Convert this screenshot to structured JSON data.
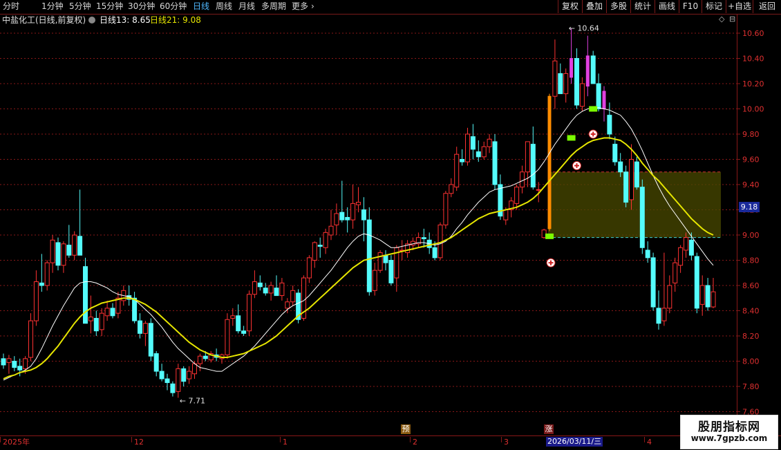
{
  "toolbar": {
    "periods": [
      "分时",
      "1分钟",
      "5分钟",
      "15分钟",
      "30分钟",
      "60分钟",
      "日线",
      "周线",
      "月线",
      "多周期",
      "更多"
    ],
    "active": "日线",
    "buttons": [
      "复权",
      "叠加",
      "多股",
      "统计",
      "画线",
      "F10",
      "标记",
      "+自选",
      "返回"
    ]
  },
  "info": {
    "stock": "中盐化工(日线,前复权)",
    "ma13_label": "日线13: 8.65",
    "ma21_label": "日线21: 9.08"
  },
  "price_axis": {
    "ticks": [
      "10.60",
      "10.40",
      "10.20",
      "10.00",
      "9.80",
      "9.60",
      "9.40",
      "9.20",
      "9.00",
      "8.80",
      "8.60",
      "8.40",
      "8.20",
      "8.00",
      "7.80",
      "7.60"
    ],
    "last_price": "9.18"
  },
  "annotations": {
    "high": "10.64",
    "low": "7.71",
    "tag_yu": "预",
    "tag_zhang": "涨"
  },
  "date_axis": {
    "labels": [
      "2025年",
      "12",
      "1",
      "2",
      "3",
      "4"
    ],
    "selected_date": "2026/03/11/三"
  },
  "colors": {
    "up": "#ff3232",
    "down": "#54fcfc",
    "ma13": "#ffffff",
    "ma21": "#e6e600",
    "grid": "#8a1818",
    "purple": "#e040e0",
    "green": "#7cfc00",
    "orange": "#ff8c00"
  },
  "chart_data": {
    "type": "candlestick",
    "ylim": [
      7.6,
      10.7
    ],
    "ohlc": [
      [
        8.02,
        8.06,
        7.94,
        7.97
      ],
      [
        7.99,
        8.05,
        7.9,
        8.02
      ],
      [
        8.0,
        8.04,
        7.92,
        7.95
      ],
      [
        7.96,
        8.02,
        7.88,
        7.93
      ],
      [
        7.94,
        8.04,
        7.9,
        8.02
      ],
      [
        8.03,
        8.38,
        8.0,
        8.32
      ],
      [
        8.32,
        8.72,
        8.28,
        8.63
      ],
      [
        8.62,
        8.85,
        8.55,
        8.6
      ],
      [
        8.6,
        8.8,
        8.56,
        8.78
      ],
      [
        8.78,
        9.0,
        8.7,
        8.96
      ],
      [
        8.94,
        8.98,
        8.72,
        8.76
      ],
      [
        8.76,
        8.95,
        8.7,
        8.93
      ],
      [
        8.92,
        9.08,
        8.82,
        8.84
      ],
      [
        8.84,
        9.03,
        8.8,
        9.0
      ],
      [
        8.99,
        9.36,
        8.86,
        8.84
      ],
      [
        8.75,
        8.82,
        8.3,
        8.3
      ],
      [
        8.32,
        8.52,
        8.22,
        8.35
      ],
      [
        8.34,
        8.4,
        8.2,
        8.24
      ],
      [
        8.25,
        8.42,
        8.2,
        8.38
      ],
      [
        8.36,
        8.48,
        8.32,
        8.42
      ],
      [
        8.42,
        8.46,
        8.34,
        8.36
      ],
      [
        8.38,
        8.55,
        8.34,
        8.5
      ],
      [
        8.48,
        8.6,
        8.44,
        8.56
      ],
      [
        8.52,
        8.6,
        8.44,
        8.49
      ],
      [
        8.5,
        8.55,
        8.3,
        8.32
      ],
      [
        8.32,
        8.38,
        8.18,
        8.22
      ],
      [
        8.22,
        8.32,
        8.12,
        8.3
      ],
      [
        8.3,
        8.34,
        8.0,
        8.04
      ],
      [
        8.06,
        8.08,
        7.88,
        7.92
      ],
      [
        7.92,
        7.98,
        7.84,
        7.86
      ],
      [
        7.86,
        7.9,
        7.77,
        7.83
      ],
      [
        7.82,
        7.84,
        7.72,
        7.75
      ],
      [
        7.76,
        7.98,
        7.71,
        7.94
      ],
      [
        7.94,
        7.96,
        7.8,
        7.84
      ],
      [
        7.86,
        7.96,
        7.82,
        7.92
      ],
      [
        7.9,
        8.0,
        7.86,
        7.98
      ],
      [
        7.98,
        8.06,
        7.92,
        8.04
      ],
      [
        8.04,
        8.08,
        8.0,
        8.02
      ],
      [
        8.01,
        8.08,
        7.99,
        8.06
      ],
      [
        8.05,
        8.1,
        8.0,
        8.03
      ],
      [
        8.02,
        8.06,
        7.98,
        8.05
      ],
      [
        8.05,
        8.38,
        8.02,
        8.33
      ],
      [
        8.34,
        8.42,
        8.28,
        8.36
      ],
      [
        8.36,
        8.45,
        8.22,
        8.24
      ],
      [
        8.24,
        8.28,
        8.2,
        8.22
      ],
      [
        8.24,
        8.56,
        8.2,
        8.53
      ],
      [
        8.53,
        8.72,
        8.5,
        8.63
      ],
      [
        8.62,
        8.68,
        8.56,
        8.59
      ],
      [
        8.58,
        8.62,
        8.52,
        8.54
      ],
      [
        8.54,
        8.63,
        8.48,
        8.6
      ],
      [
        8.58,
        8.68,
        8.52,
        8.52
      ],
      [
        8.52,
        8.66,
        8.48,
        8.62
      ],
      [
        8.42,
        8.5,
        8.38,
        8.47
      ],
      [
        8.47,
        8.6,
        8.44,
        8.56
      ],
      [
        8.54,
        8.57,
        8.3,
        8.33
      ],
      [
        8.34,
        8.68,
        8.32,
        8.66
      ],
      [
        8.66,
        8.84,
        8.62,
        8.82
      ],
      [
        8.8,
        8.95,
        8.74,
        8.94
      ],
      [
        8.92,
        8.98,
        8.82,
        8.91
      ],
      [
        8.9,
        9.05,
        8.85,
        9.02
      ],
      [
        9.0,
        9.2,
        8.96,
        9.07
      ],
      [
        9.08,
        9.25,
        9.0,
        9.17
      ],
      [
        9.18,
        9.43,
        9.1,
        9.12
      ],
      [
        9.14,
        9.22,
        9.02,
        9.12
      ],
      [
        9.12,
        9.4,
        9.05,
        9.25
      ],
      [
        9.24,
        9.38,
        9.18,
        9.26
      ],
      [
        9.2,
        9.3,
        8.95,
        9.12
      ],
      [
        9.12,
        9.22,
        8.52,
        8.55
      ],
      [
        8.56,
        8.78,
        8.52,
        8.72
      ],
      [
        8.72,
        8.88,
        8.7,
        8.86
      ],
      [
        8.84,
        8.88,
        8.72,
        8.78
      ],
      [
        8.8,
        8.84,
        8.6,
        8.62
      ],
      [
        8.66,
        8.92,
        8.55,
        8.9
      ],
      [
        8.88,
        8.96,
        8.8,
        8.88
      ],
      [
        8.86,
        8.96,
        8.82,
        8.93
      ],
      [
        8.92,
        8.98,
        8.88,
        8.95
      ],
      [
        8.93,
        9.02,
        8.9,
        8.98
      ],
      [
        8.98,
        9.05,
        8.9,
        8.97
      ],
      [
        8.96,
        9.02,
        8.85,
        8.9
      ],
      [
        8.9,
        8.95,
        8.8,
        8.82
      ],
      [
        8.82,
        9.1,
        8.8,
        9.08
      ],
      [
        9.08,
        9.35,
        9.05,
        9.33
      ],
      [
        9.33,
        9.45,
        9.3,
        9.4
      ],
      [
        9.38,
        9.7,
        9.35,
        9.64
      ],
      [
        9.6,
        9.68,
        9.55,
        9.58
      ],
      [
        9.58,
        9.85,
        9.55,
        9.8
      ],
      [
        9.78,
        9.88,
        9.6,
        9.68
      ],
      [
        9.66,
        9.75,
        9.58,
        9.62
      ],
      [
        9.62,
        9.74,
        9.6,
        9.7
      ],
      [
        9.7,
        9.8,
        9.65,
        9.76
      ],
      [
        9.74,
        9.8,
        9.36,
        9.4
      ],
      [
        9.4,
        9.48,
        9.12,
        9.15
      ],
      [
        9.12,
        9.22,
        9.08,
        9.2
      ],
      [
        9.2,
        9.3,
        9.14,
        9.27
      ],
      [
        9.25,
        9.4,
        9.2,
        9.38
      ],
      [
        9.38,
        9.55,
        9.33,
        9.5
      ],
      [
        9.5,
        9.72,
        9.38,
        9.74
      ],
      [
        9.72,
        9.86,
        9.36,
        9.38
      ],
      [
        9.36,
        9.42,
        9.26,
        9.36
      ],
      [
        8.98,
        9.05,
        8.97,
        9.04
      ],
      [
        9.05,
        10.12,
        9.03,
        10.1
      ],
      [
        10.1,
        10.55,
        10.0,
        10.38
      ],
      [
        10.28,
        10.36,
        10.12,
        10.12
      ],
      [
        10.12,
        10.32,
        10.05,
        10.28
      ],
      [
        10.25,
        10.64,
        10.2,
        10.4
      ],
      [
        10.4,
        10.48,
        10.0,
        10.03
      ],
      [
        10.02,
        10.25,
        9.98,
        10.2
      ],
      [
        10.18,
        10.58,
        10.1,
        10.42
      ],
      [
        10.42,
        10.46,
        10.2,
        10.2
      ],
      [
        10.2,
        10.28,
        9.98,
        10.0
      ],
      [
        10.0,
        10.18,
        9.9,
        10.14
      ],
      [
        9.95,
        10.05,
        9.76,
        9.8
      ],
      [
        9.72,
        9.78,
        9.55,
        9.58
      ],
      [
        9.58,
        9.65,
        9.46,
        9.5
      ],
      [
        9.5,
        9.55,
        9.22,
        9.26
      ],
      [
        9.28,
        9.72,
        9.2,
        9.6
      ],
      [
        9.58,
        9.62,
        9.36,
        9.38
      ],
      [
        9.38,
        9.44,
        8.85,
        8.9
      ],
      [
        8.88,
        8.95,
        8.78,
        8.82
      ],
      [
        8.82,
        8.86,
        8.4,
        8.43
      ],
      [
        8.42,
        8.56,
        8.25,
        8.3
      ],
      [
        8.32,
        8.86,
        8.28,
        8.42
      ],
      [
        8.42,
        8.68,
        8.38,
        8.6
      ],
      [
        8.62,
        8.82,
        8.55,
        8.78
      ],
      [
        8.76,
        8.92,
        8.7,
        8.9
      ],
      [
        8.88,
        9.02,
        8.82,
        8.98
      ],
      [
        8.96,
        9.02,
        8.8,
        8.84
      ],
      [
        8.83,
        8.86,
        8.38,
        8.42
      ],
      [
        8.45,
        8.68,
        8.36,
        8.6
      ],
      [
        8.6,
        8.66,
        8.4,
        8.43
      ],
      [
        8.43,
        8.66,
        8.42,
        8.55
      ]
    ],
    "ma13": [
      7.85,
      7.87,
      7.89,
      7.91,
      7.93,
      7.96,
      8.02,
      8.1,
      8.19,
      8.28,
      8.36,
      8.44,
      8.51,
      8.58,
      8.62,
      8.63,
      8.63,
      8.62,
      8.6,
      8.58,
      8.55,
      8.53,
      8.52,
      8.51,
      8.49,
      8.45,
      8.41,
      8.37,
      8.32,
      8.27,
      8.21,
      8.15,
      8.1,
      8.06,
      8.02,
      7.98,
      7.95,
      7.94,
      7.93,
      7.92,
      7.92,
      7.95,
      7.98,
      8.01,
      8.04,
      8.08,
      8.12,
      8.17,
      8.22,
      8.27,
      8.32,
      8.37,
      8.41,
      8.44,
      8.46,
      8.48,
      8.52,
      8.57,
      8.62,
      8.67,
      8.72,
      8.78,
      8.84,
      8.9,
      8.95,
      8.99,
      9.01,
      9.0,
      8.98,
      8.96,
      8.93,
      8.9,
      8.9,
      8.91,
      8.92,
      8.93,
      8.94,
      8.94,
      8.93,
      8.92,
      8.93,
      8.95,
      8.99,
      9.05,
      9.1,
      9.16,
      9.21,
      9.26,
      9.3,
      9.34,
      9.36,
      9.37,
      9.38,
      9.39,
      9.41,
      9.43,
      9.45,
      9.48,
      9.52,
      9.58,
      9.65,
      9.72,
      9.78,
      9.84,
      9.9,
      9.95,
      9.98,
      10.0,
      10.01,
      10.01,
      10.0,
      9.99,
      9.97,
      9.95,
      9.9,
      9.84,
      9.76,
      9.67,
      9.57,
      9.47,
      9.38,
      9.3,
      9.23,
      9.17,
      9.11,
      9.05,
      8.99,
      8.93,
      8.87,
      8.81,
      8.76
    ],
    "ma21": [
      7.86,
      7.88,
      7.89,
      7.91,
      7.92,
      7.93,
      7.95,
      7.98,
      8.02,
      8.07,
      8.12,
      8.18,
      8.24,
      8.3,
      8.35,
      8.39,
      8.42,
      8.44,
      8.46,
      8.47,
      8.48,
      8.49,
      8.5,
      8.5,
      8.49,
      8.47,
      8.45,
      8.42,
      8.39,
      8.35,
      8.31,
      8.27,
      8.23,
      8.19,
      8.15,
      8.12,
      8.09,
      8.07,
      8.05,
      8.04,
      8.03,
      8.03,
      8.04,
      8.05,
      8.06,
      8.08,
      8.1,
      8.12,
      8.14,
      8.17,
      8.2,
      8.24,
      8.28,
      8.32,
      8.36,
      8.39,
      8.42,
      8.46,
      8.5,
      8.54,
      8.58,
      8.62,
      8.66,
      8.7,
      8.74,
      8.77,
      8.8,
      8.81,
      8.82,
      8.83,
      8.84,
      8.85,
      8.86,
      8.87,
      8.88,
      8.89,
      8.9,
      8.91,
      8.92,
      8.93,
      8.94,
      8.96,
      8.98,
      9.01,
      9.04,
      9.07,
      9.1,
      9.13,
      9.15,
      9.17,
      9.18,
      9.19,
      9.2,
      9.21,
      9.22,
      9.24,
      9.26,
      9.29,
      9.33,
      9.38,
      9.43,
      9.48,
      9.53,
      9.58,
      9.63,
      9.67,
      9.7,
      9.73,
      9.75,
      9.76,
      9.77,
      9.77,
      9.76,
      9.75,
      9.72,
      9.68,
      9.63,
      9.57,
      9.52,
      9.47,
      9.43,
      9.38,
      9.33,
      9.28,
      9.23,
      9.18,
      9.13,
      9.09,
      9.05,
      9.02,
      9.0
    ]
  }
}
